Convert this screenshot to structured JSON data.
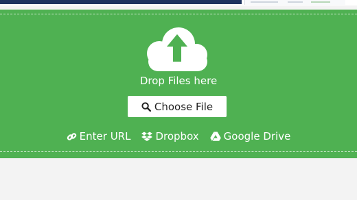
{
  "drop_zone": {
    "drop_label": "Drop Files here",
    "choose_button_label": "Choose File",
    "sources": [
      {
        "label": "Enter URL",
        "icon": "link-icon"
      },
      {
        "label": "Dropbox",
        "icon": "dropbox-icon"
      },
      {
        "label": "Google Drive",
        "icon": "google-drive-icon"
      }
    ]
  },
  "colors": {
    "accent_green": "#4fb152",
    "button_bg": "#ffffff",
    "page_bg": "#f3f3f3"
  }
}
